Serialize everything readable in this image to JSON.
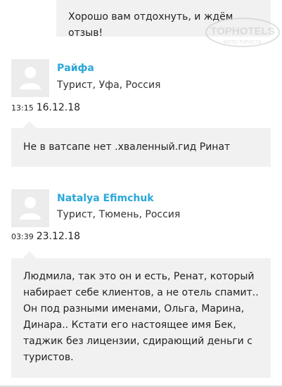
{
  "reply": {
    "text": "Хорошо вам отдохнуть, и ждём отзыв!"
  },
  "watermark": {
    "line1": "TOPHOTELS",
    "line2": "ФОТО ТУРИСТА"
  },
  "comments": [
    {
      "author": "Райфа",
      "meta": "Турист, Уфа, Россия",
      "time": "13:15",
      "date": "16.12.18",
      "text": "Не в ватсапе нет .хваленный.гид Ринат"
    },
    {
      "author": "Natalya Efimchuk",
      "meta": "Турист, Тюмень, Россия",
      "time": "03:39",
      "date": "23.12.18",
      "text": "Людмила, так это он и есть, Ренат, который набирает себе клиентов, а не отель спамит.. Он под разными именами, Ольга, Марина, Динара.. Кстати его настоящее имя Бек, таджик без лицензии, сдирающий деньги с туристов."
    }
  ]
}
